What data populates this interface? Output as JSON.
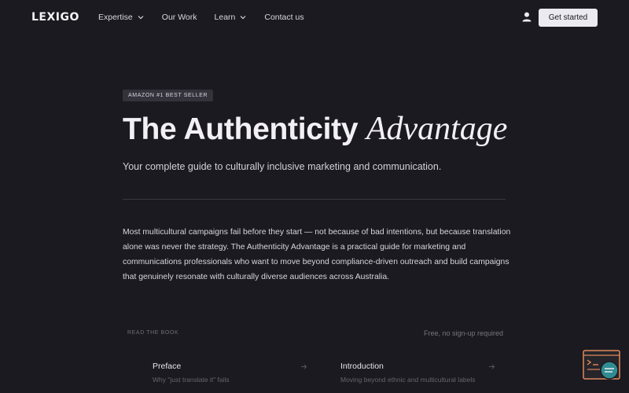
{
  "header": {
    "logo": "LEXIGO",
    "nav": [
      {
        "label": "Expertise",
        "has_dropdown": true
      },
      {
        "label": "Our Work",
        "has_dropdown": false
      },
      {
        "label": "Learn",
        "has_dropdown": true
      },
      {
        "label": "Contact us",
        "has_dropdown": false
      }
    ],
    "user_icon": "user-icon",
    "cta_label": "Get started"
  },
  "hero": {
    "badge": "AMAZON #1 BEST SELLER",
    "title_main": "The Authenticity",
    "title_italic": "Advantage",
    "subtitle": "Your complete guide to culturally inclusive marketing and communication.",
    "body": "Most multicultural campaigns fail before they start — not because of bad intentions, but because translation alone was never the strategy. The Authenticity Advantage is a practical guide for marketing and communications professionals who want to move beyond compliance-driven outreach and build campaigns that genuinely resonate with culturally diverse audiences across Australia."
  },
  "book": {
    "label": "READ THE BOOK",
    "note": "Free, no sign-up required",
    "chapters": [
      {
        "title": "Preface",
        "subtitle": "Why \"just translate it\" fails"
      },
      {
        "title": "Introduction",
        "subtitle": "Moving beyond ethnic and multicultural labels"
      }
    ]
  },
  "colors": {
    "background": "#1b1a20",
    "cta_background": "#eceaf1",
    "chat_accent": "#e0895a",
    "chat_teal": "#2f8c92"
  },
  "icons": [
    "chevron-down-icon",
    "user-icon",
    "arrow-right-icon",
    "chat-widget-icon"
  ]
}
